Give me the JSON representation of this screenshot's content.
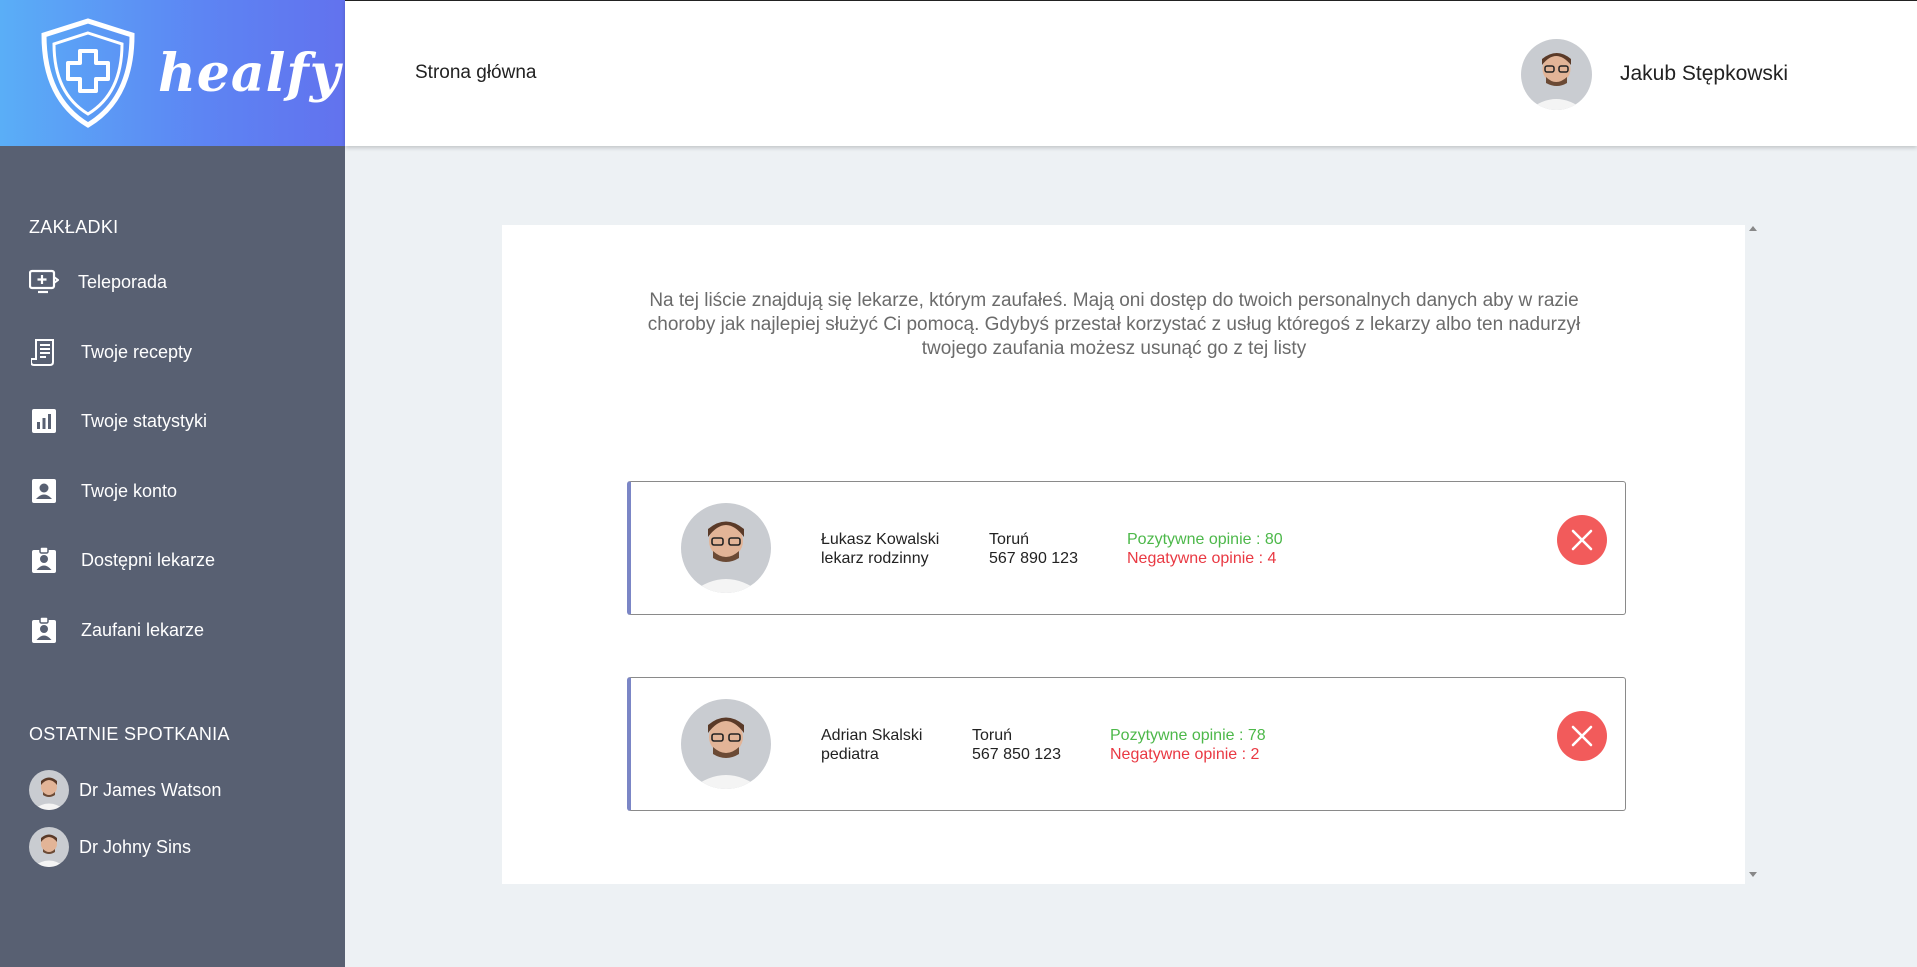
{
  "brand": {
    "name": "healfy"
  },
  "header": {
    "home_link": "Strona główna",
    "user_name": "Jakub Stępkowski"
  },
  "sidebar": {
    "tabs_heading": "ZAKŁADKI",
    "items": [
      {
        "label": "Teleporada",
        "icon": "video-call-icon"
      },
      {
        "label": "Twoje recepty",
        "icon": "receipt-icon"
      },
      {
        "label": "Twoje statystyki",
        "icon": "chart-icon"
      },
      {
        "label": "Twoje konto",
        "icon": "account-icon"
      },
      {
        "label": "Dostępni lekarze",
        "icon": "badge-icon"
      },
      {
        "label": "Zaufani lekarze",
        "icon": "badge-icon"
      }
    ],
    "recent_heading": "OSTATNIE SPOTKANIA",
    "recent": [
      {
        "label": "Dr James Watson"
      },
      {
        "label": "Dr Johny Sins"
      }
    ]
  },
  "main": {
    "intro": "Na tej liście znajdują się lekarze, którym zaufałeś. Mają oni dostęp do twoich personalnych danych aby w razie choroby jak najlepiej służyć Ci pomocą. Gdybyś przestał korzystać z usług któregoś z lekarzy albo ten nadurzył twojego zaufania możesz usunąć go z tej listy",
    "doctors": [
      {
        "name": "Łukasz Kowalski",
        "specialty": "lekarz rodzinny",
        "city": "Toruń",
        "phone": "567 890 123",
        "positive": "Pozytywne opinie : 80",
        "negative": "Negatywne opinie : 4"
      },
      {
        "name": "Adrian Skalski",
        "specialty": "pediatra",
        "city": "Toruń",
        "phone": "567 850 123",
        "positive": "Pozytywne opinie : 78",
        "negative": "Negatywne opinie : 2"
      }
    ]
  },
  "colors": {
    "accent": "#6272ee",
    "sidebar": "#586072",
    "positive": "#4db84a",
    "negative": "#e93943",
    "remove": "#f25b5b"
  }
}
